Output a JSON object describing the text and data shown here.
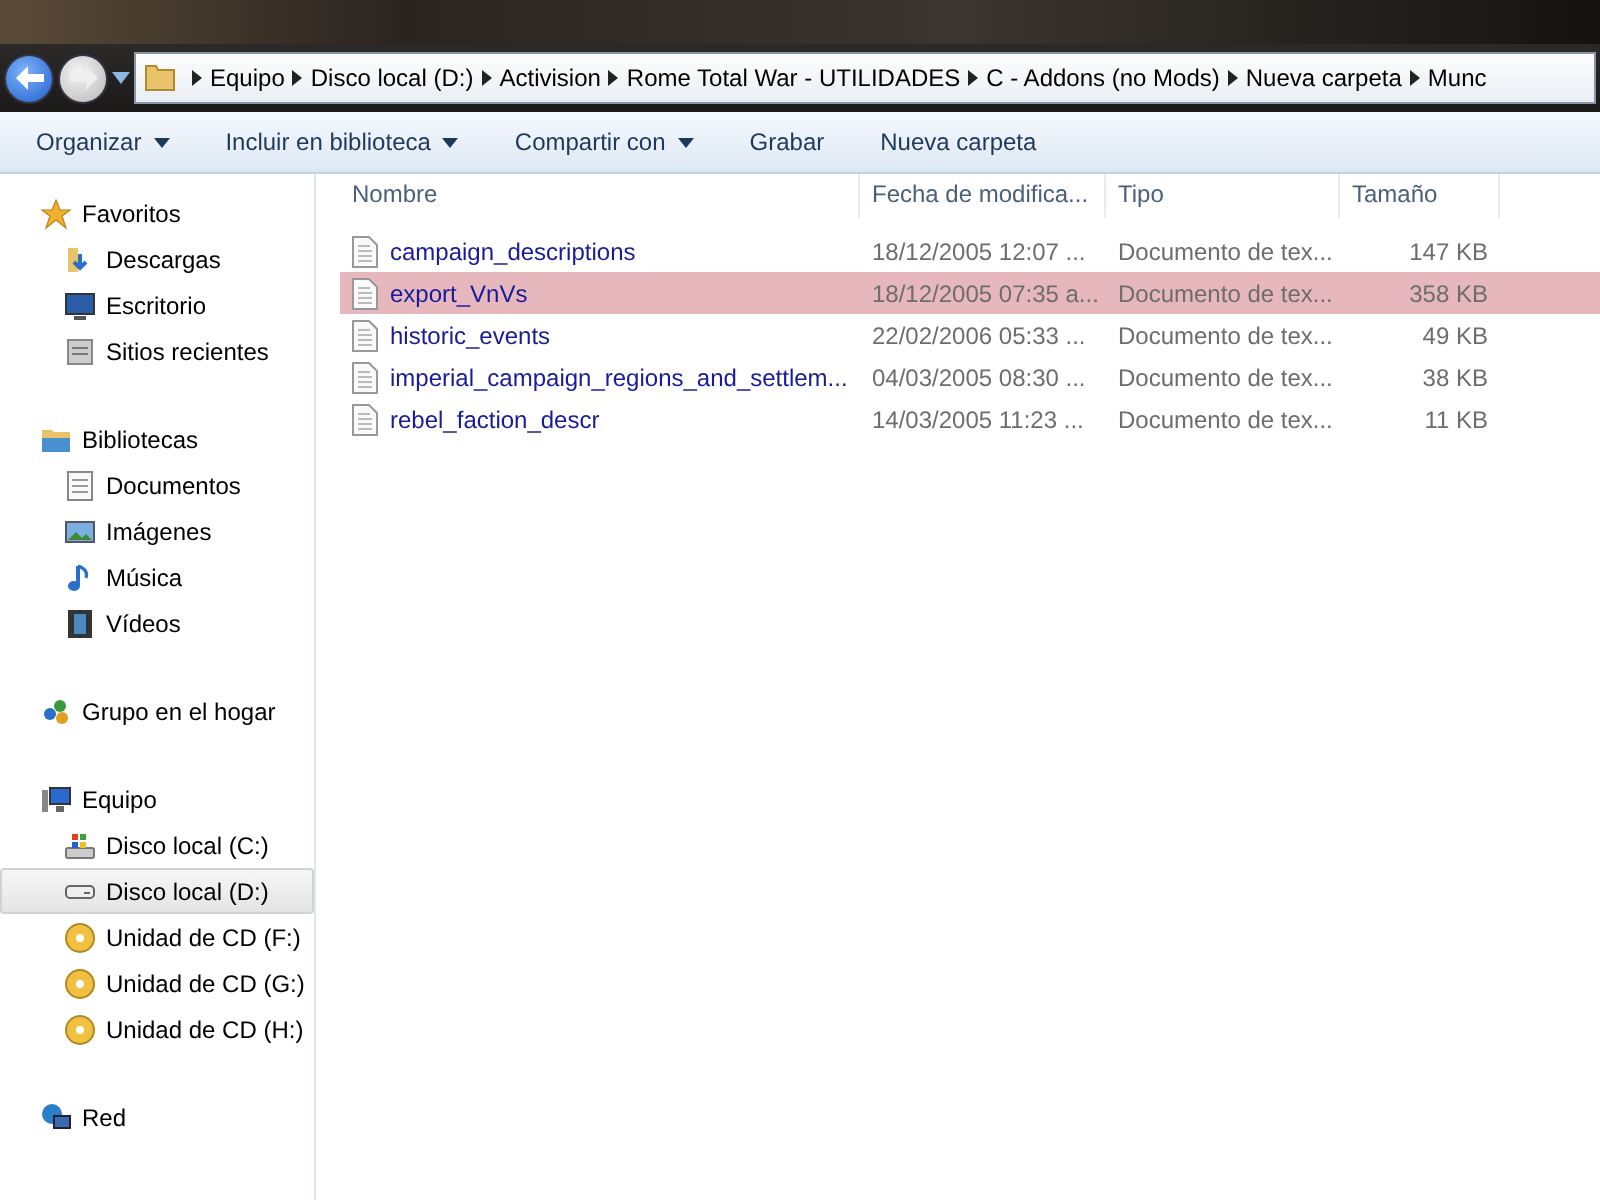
{
  "breadcrumb": [
    "Equipo",
    "Disco local (D:)",
    "Activision",
    "Rome Total War - UTILIDADES",
    "C - Addons (no Mods)",
    "Nueva carpeta",
    "Munc"
  ],
  "toolbar": [
    {
      "label": "Organizar",
      "dropdown": true
    },
    {
      "label": "Incluir en biblioteca",
      "dropdown": true
    },
    {
      "label": "Compartir con",
      "dropdown": true
    },
    {
      "label": "Grabar",
      "dropdown": false
    },
    {
      "label": "Nueva carpeta",
      "dropdown": false
    }
  ],
  "sidebar": [
    {
      "label": "Favoritos",
      "kind": "star",
      "selected": false,
      "children": [
        {
          "label": "Descargas",
          "kind": "downloads",
          "selected": false
        },
        {
          "label": "Escritorio",
          "kind": "desktop",
          "selected": false
        },
        {
          "label": "Sitios recientes",
          "kind": "recent",
          "selected": false
        }
      ]
    },
    {
      "label": "Bibliotecas",
      "kind": "library",
      "selected": false,
      "children": [
        {
          "label": "Documentos",
          "kind": "document",
          "selected": false
        },
        {
          "label": "Imágenes",
          "kind": "image",
          "selected": false
        },
        {
          "label": "Música",
          "kind": "music",
          "selected": false
        },
        {
          "label": "Vídeos",
          "kind": "video",
          "selected": false
        }
      ]
    },
    {
      "label": "Grupo en el hogar",
      "kind": "homegroup",
      "selected": false
    },
    {
      "label": "Equipo",
      "kind": "computer",
      "selected": false,
      "children": [
        {
          "label": "Disco local (C:)",
          "kind": "windrive",
          "selected": false
        },
        {
          "label": "Disco local (D:)",
          "kind": "drive",
          "selected": true
        },
        {
          "label": "Unidad de CD (F:)",
          "kind": "cd",
          "selected": false
        },
        {
          "label": "Unidad de CD (G:)",
          "kind": "cd",
          "selected": false
        },
        {
          "label": "Unidad de CD (H:)",
          "kind": "cd",
          "selected": false
        }
      ]
    },
    {
      "label": "Red",
      "kind": "network",
      "selected": false
    }
  ],
  "table": {
    "columns": [
      "Nombre",
      "Fecha de modifica...",
      "Tipo",
      "Tamaño"
    ],
    "rows": [
      {
        "name": "campaign_descriptions",
        "date": "18/12/2005 12:07 ...",
        "type": "Documento de tex...",
        "size": "147 KB",
        "selected": false
      },
      {
        "name": "export_VnVs",
        "date": "18/12/2005 07:35 a...",
        "type": "Documento de tex...",
        "size": "358 KB",
        "selected": true
      },
      {
        "name": "historic_events",
        "date": "22/02/2006 05:33 ...",
        "type": "Documento de tex...",
        "size": "49 KB",
        "selected": false
      },
      {
        "name": "imperial_campaign_regions_and_settlem...",
        "date": "04/03/2005 08:30 ...",
        "type": "Documento de tex...",
        "size": "38 KB",
        "selected": false
      },
      {
        "name": "rebel_faction_descr",
        "date": "14/03/2005 11:23 ...",
        "type": "Documento de tex...",
        "size": "11 KB",
        "selected": false
      }
    ]
  }
}
